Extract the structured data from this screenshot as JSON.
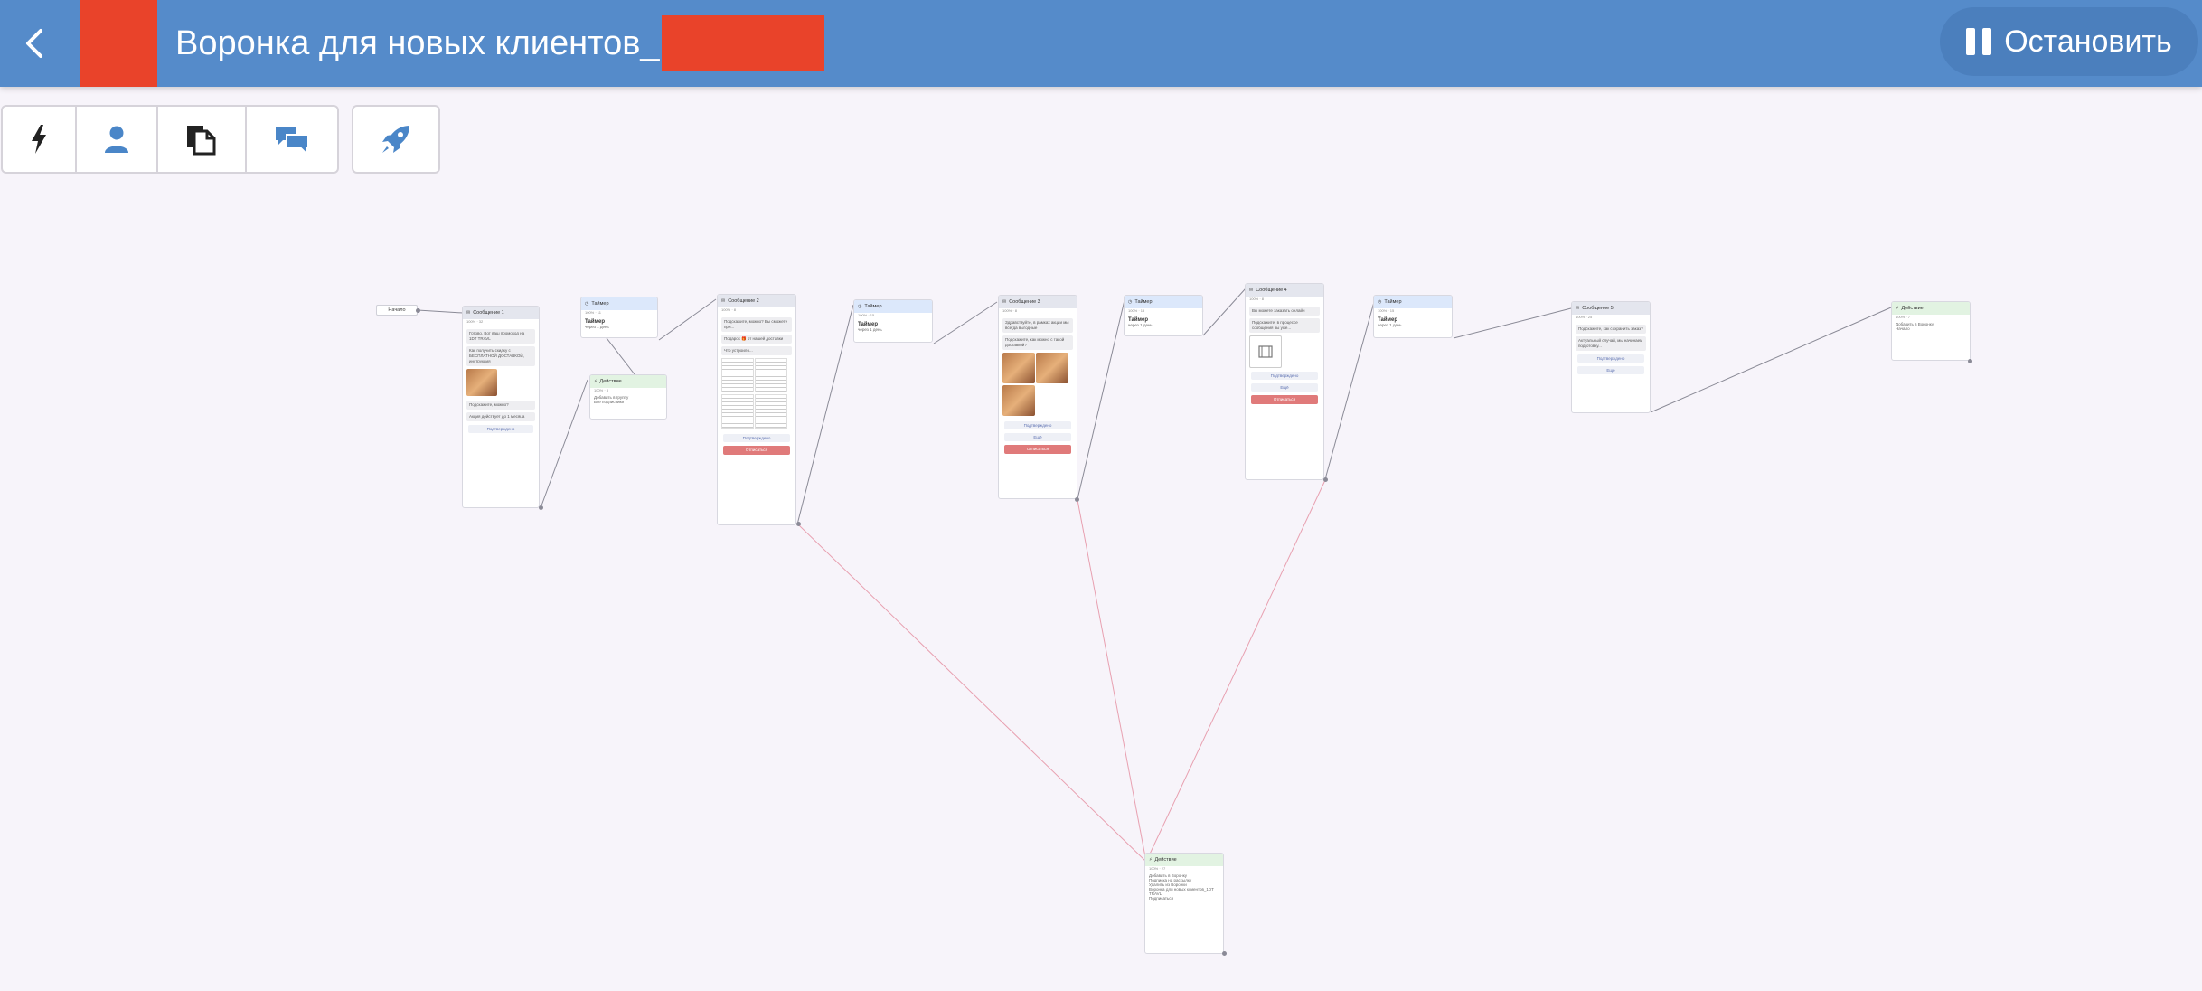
{
  "header": {
    "title": "Воронка для новых клиентов_",
    "stop_label": "Остановить"
  },
  "toolbar": {
    "tools": [
      "lightning-icon",
      "person-icon",
      "document-icon",
      "chat-icon"
    ],
    "launch_tool": "rocket-icon"
  },
  "colors": {
    "header_bg": "#558bca",
    "redaction": "#e9432a",
    "canvas_bg": "#f7f4fa",
    "edge_red": "#e8a0b0",
    "edge_gray": "#8a8a96"
  },
  "flow": {
    "start_label": "Начало",
    "msg1": {
      "title": "Сообщение 1",
      "meta": "100% · 32",
      "b1": "Готово. Вот ваш промокод на 1DT TRAVL",
      "b2": "Как получить скидку с БЕСПЛАТНОЙ ДОСТАВКОЙ, инструкция",
      "b3": "Подскажите, можно?",
      "b4": "Акция действует до 1 месяца",
      "button": "Подтверждено"
    },
    "timer1": {
      "title": "Таймер",
      "meta": "100% · 11",
      "body_title": "Таймер",
      "body_sub": "через 1 день"
    },
    "action1": {
      "title": "Действие",
      "meta": "100% · 8",
      "body": "Добавить в группу",
      "body2": "Все подписчики"
    },
    "msg2": {
      "title": "Сообщение 2",
      "meta": "100% · 8",
      "b1": "Подскажите, можно? Вы сможете при...",
      "b2": "Подарок 🎁 от нашей доставки",
      "b3": "Что устроило...",
      "button1": "Подтверждено",
      "button2": "Отписаться"
    },
    "timer2": {
      "title": "Таймер",
      "meta": "100% · 15",
      "body_title": "Таймер",
      "body_sub": "через 1 день"
    },
    "msg3": {
      "title": "Сообщение 3",
      "meta": "100% · 8",
      "b1": "Здравствуйте, в рамках акции мы всегда выгодные",
      "b2": "Подскажите, как можно с такой доставкой?",
      "button1": "Подтверждено",
      "button2": "Ещё",
      "button3": "Отписаться"
    },
    "timer3": {
      "title": "Таймер",
      "meta": "100% · 15",
      "body_title": "Таймер",
      "body_sub": "через 1 день"
    },
    "msg4": {
      "title": "Сообщение 4",
      "meta": "100% · 8",
      "b1": "Вы можете заказать онлайн",
      "b2": "Подскажите, в процессе сообщения вы уже...",
      "button1": "Подтверждено",
      "button2": "Ещё",
      "button3": "Отписаться"
    },
    "timer4": {
      "title": "Таймер",
      "meta": "100% · 15",
      "body_title": "Таймер",
      "body_sub": "через 1 день"
    },
    "msg5": {
      "title": "Сообщение 5",
      "meta": "100% · 25",
      "b1": "Подскажите, как сохранить заказ?",
      "b2": "Актуальный случай, мы начинаем подготовку...",
      "button1": "Подтверждено",
      "button2": "Ещё"
    },
    "action2": {
      "title": "Действие",
      "meta": "100% · 7",
      "body": "Добавить в Воронку",
      "body2": "Начало"
    },
    "action3": {
      "title": "Действие",
      "meta": "100% · 27",
      "body": "Добавить в Воронку",
      "body2": "Подписка на рассылку",
      "body3": "Удалить из Воронки",
      "body4": "Воронка для новых клиентов_1DT TRAVL",
      "body5": "Подписаться"
    }
  }
}
